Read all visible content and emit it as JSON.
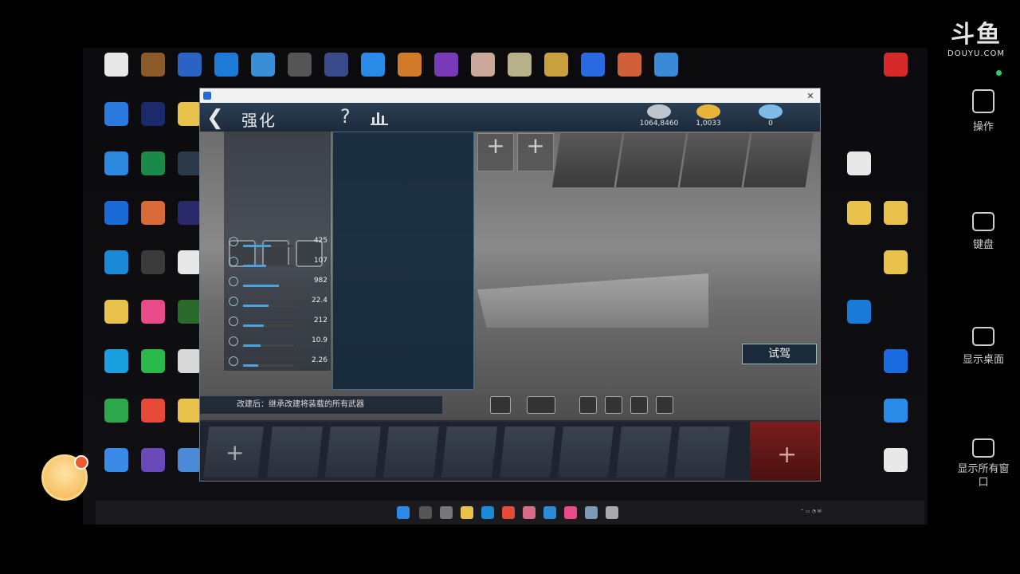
{
  "douyu": {
    "big": "斗鱼",
    "small": "DOUYU.COM"
  },
  "right_panel": [
    {
      "label": "操作",
      "icon": "operation-icon"
    },
    {
      "label": "键盘",
      "icon": "keyboard-icon"
    },
    {
      "label": "显示桌面",
      "icon": "show-desktop-icon"
    },
    {
      "label": "显示所有窗口",
      "icon": "all-windows-icon"
    }
  ],
  "desktop_icons": [],
  "game": {
    "title": "强化",
    "resources": [
      {
        "value": "1064,8460",
        "color": "#bfc5cc"
      },
      {
        "value": "1,0033",
        "color": "#e6b43a"
      },
      {
        "value": "0",
        "color": "#7fb9e6"
      }
    ],
    "left_panel": {
      "rows": [
        {
          "value": "425",
          "fill": 0.55
        },
        {
          "value": "107",
          "fill": 0.45
        },
        {
          "value": "982",
          "fill": 0.7
        },
        {
          "value": "22.4",
          "fill": 0.5
        },
        {
          "value": "212",
          "fill": 0.4
        },
        {
          "value": "10.9",
          "fill": 0.35
        },
        {
          "value": "2.26",
          "fill": 0.3
        }
      ]
    },
    "description": {
      "paragraphs": [],
      "footer": ""
    },
    "tabs": [],
    "trial_button": "试驾",
    "bottom_message": "改建后：继承改建将装载的所有武器"
  },
  "taskbar": {
    "time": "",
    "date": ""
  }
}
